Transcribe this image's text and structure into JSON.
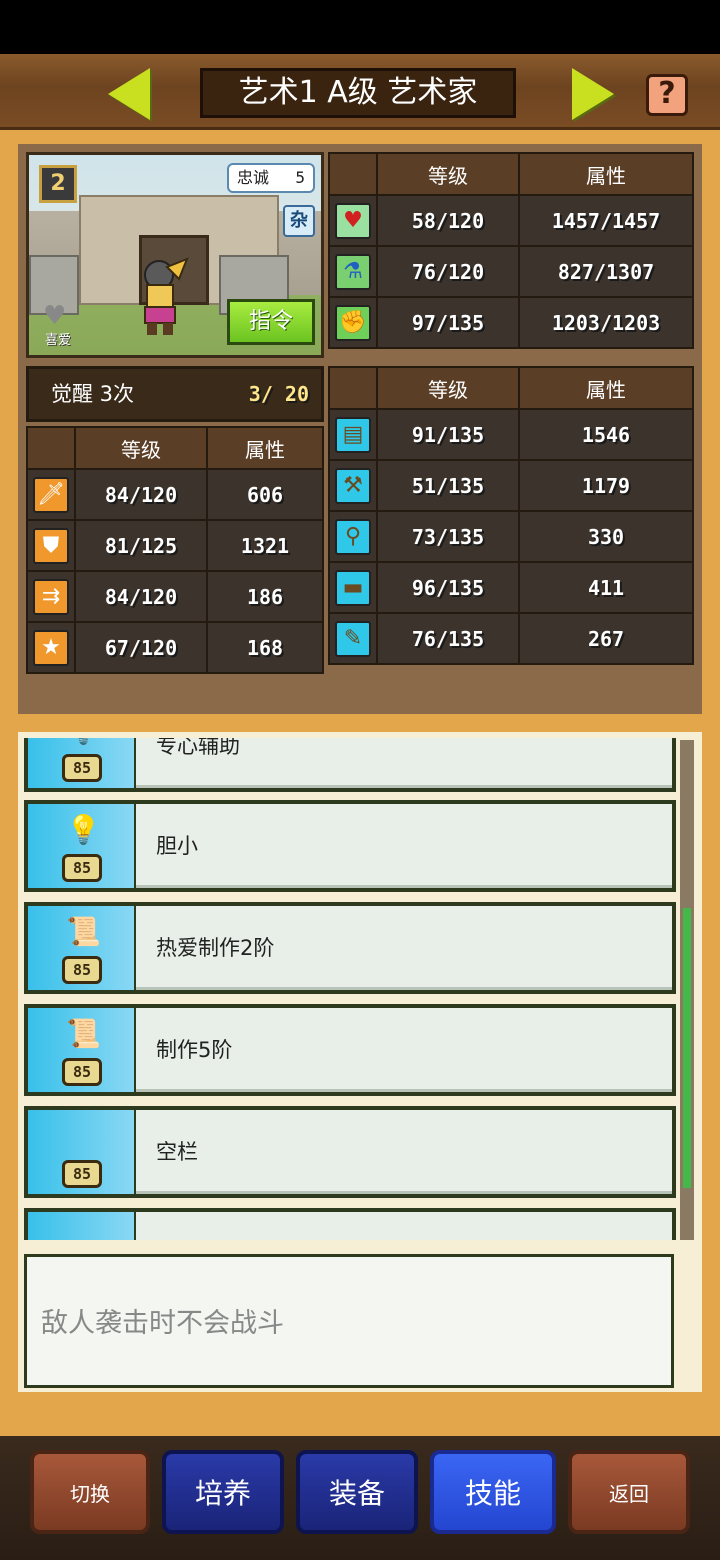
{
  "header": {
    "title": "艺术1 A级 艺术家",
    "help_label": "?"
  },
  "portrait": {
    "rank": "2",
    "loyalty_label": "忠诚",
    "loyalty_value": "5",
    "type_badge": "杂",
    "like_label": "喜爱",
    "command_label": "指令"
  },
  "top_table": {
    "headers": [
      "等级",
      "属性"
    ],
    "rows": [
      {
        "icon": "heart-icon",
        "level": "58/120",
        "value": "1457/1457"
      },
      {
        "icon": "potion-icon",
        "level": "76/120",
        "value": "827/1307"
      },
      {
        "icon": "strength-icon",
        "level": "97/135",
        "value": "1203/1203"
      }
    ]
  },
  "awaken": {
    "label": "觉醒 3次",
    "count": "3/ 20"
  },
  "left_table": {
    "headers": [
      "等级",
      "属性"
    ],
    "rows": [
      {
        "icon": "sword-icon",
        "level": "84/120",
        "value": "606"
      },
      {
        "icon": "shield-icon",
        "level": "81/125",
        "value": "1321"
      },
      {
        "icon": "arrows-icon",
        "level": "84/120",
        "value": "186"
      },
      {
        "icon": "star-icon",
        "level": "67/120",
        "value": "168"
      }
    ]
  },
  "right_table": {
    "headers": [
      "等级",
      "属性"
    ],
    "rows": [
      {
        "icon": "book-icon",
        "level": "91/135",
        "value": "1546"
      },
      {
        "icon": "hammer-icon",
        "level": "51/135",
        "value": "1179"
      },
      {
        "icon": "shovel-icon",
        "level": "73/135",
        "value": "330"
      },
      {
        "icon": "chest-icon",
        "level": "96/135",
        "value": "411"
      },
      {
        "icon": "scroll-icon",
        "level": "76/135",
        "value": "267"
      }
    ]
  },
  "skills": [
    {
      "name": "专心辅助",
      "level": "85",
      "icon": "lightbulb-icon"
    },
    {
      "name": "胆小",
      "level": "85",
      "icon": "lightbulb-icon"
    },
    {
      "name": "热爱制作2阶",
      "level": "85",
      "icon": "scroll-icon"
    },
    {
      "name": "制作5阶",
      "level": "85",
      "icon": "scroll-icon"
    },
    {
      "name": "空栏",
      "level": "85",
      "icon": ""
    },
    {
      "name": "",
      "level": "",
      "icon": ""
    }
  ],
  "description": "敌人袭击时不会战斗",
  "bottom_nav": {
    "switch": "切换",
    "train": "培养",
    "equip": "装备",
    "skills": "技能",
    "back": "返回"
  },
  "colors": {
    "accent_orange": "#e4a64a",
    "stat_level": "#ffe68a",
    "stat_value": "#8ef0e8",
    "active_tab": "#3a66f4"
  }
}
